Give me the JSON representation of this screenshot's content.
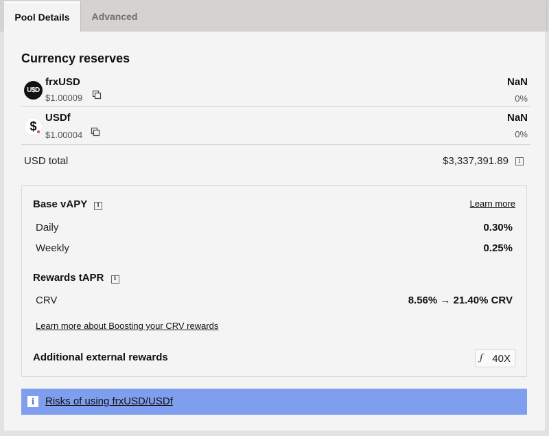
{
  "tabs": [
    {
      "label": "Pool Details",
      "active": true
    },
    {
      "label": "Advanced",
      "active": false
    }
  ],
  "reserves": {
    "title": "Currency reserves",
    "tokens": [
      {
        "symbol": "frxUSD",
        "logo_text": "U$D",
        "price": "$1.00009",
        "amount": "NaN",
        "percent": "0%"
      },
      {
        "symbol": "USDf",
        "logo_text": "$",
        "price": "$1.00004",
        "amount": "NaN",
        "percent": "0%"
      }
    ],
    "usd_total_label": "USD total",
    "usd_total_value": "$3,337,391.89"
  },
  "apy": {
    "base_title": "Base vAPY",
    "learn_more": "Learn more",
    "daily_label": "Daily",
    "daily_value": "0.30%",
    "weekly_label": "Weekly",
    "weekly_value": "0.25%",
    "rewards_title": "Rewards tAPR",
    "crv_label": "CRV",
    "crv_value": "8.56% → 21.40% CRV",
    "boost_link": "Learn more about Boosting your CRV rewards",
    "external_title": "Additional external rewards",
    "external_badge": "40X"
  },
  "risk": {
    "link": "Risks of using frxUSD/USDf"
  },
  "colors": {
    "risk_banner": "#7f9eee",
    "panel_bg": "#f4f4f4",
    "tabbar_bg": "#d5d3d1"
  },
  "icons": [
    "copy-icon",
    "info-icon",
    "frxusd-logo",
    "usdf-logo",
    "curve-icon"
  ]
}
